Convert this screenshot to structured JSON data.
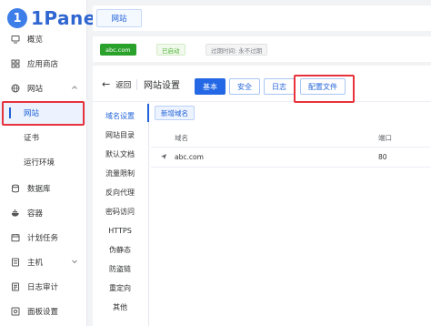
{
  "brand": {
    "logo_mark": "1",
    "name": "1Panel"
  },
  "sidebar": {
    "items": [
      {
        "label": "概览",
        "icon": "monitor-icon"
      },
      {
        "label": "应用商店",
        "icon": "grid-icon"
      },
      {
        "label": "网站",
        "icon": "globe-icon"
      },
      {
        "label": "数据库",
        "icon": "database-icon"
      },
      {
        "label": "容器",
        "icon": "docker-icon"
      },
      {
        "label": "计划任务",
        "icon": "calendar-icon"
      },
      {
        "label": "主机",
        "icon": "host-icon"
      },
      {
        "label": "日志审计",
        "icon": "log-icon"
      },
      {
        "label": "面板设置",
        "icon": "settings-icon"
      }
    ],
    "sub_items": [
      {
        "label": "网站"
      },
      {
        "label": "证书"
      },
      {
        "label": "运行环境"
      }
    ]
  },
  "tabs": {
    "site": "网站"
  },
  "info": {
    "domain": "abc.com",
    "status": "已启动",
    "expire": "过期时间: 永不过期"
  },
  "header": {
    "back": "返回",
    "title": "网站设置",
    "buttons": [
      "基本",
      "安全",
      "日志",
      "配置文件"
    ]
  },
  "left_nav": [
    "域名设置",
    "网站目录",
    "默认文档",
    "流量限制",
    "反向代理",
    "密码访问",
    "HTTPS",
    "伪静态",
    "防盗链",
    "重定向",
    "其他"
  ],
  "domains": {
    "add_label": "新增域名",
    "columns": {
      "domain": "域名",
      "port": "端口"
    },
    "rows": [
      {
        "domain": "abc.com",
        "port": "80"
      }
    ]
  },
  "colors": {
    "primary": "#2468e5",
    "highlight": "#e8323c",
    "domain_tag": "#2aa12a"
  }
}
